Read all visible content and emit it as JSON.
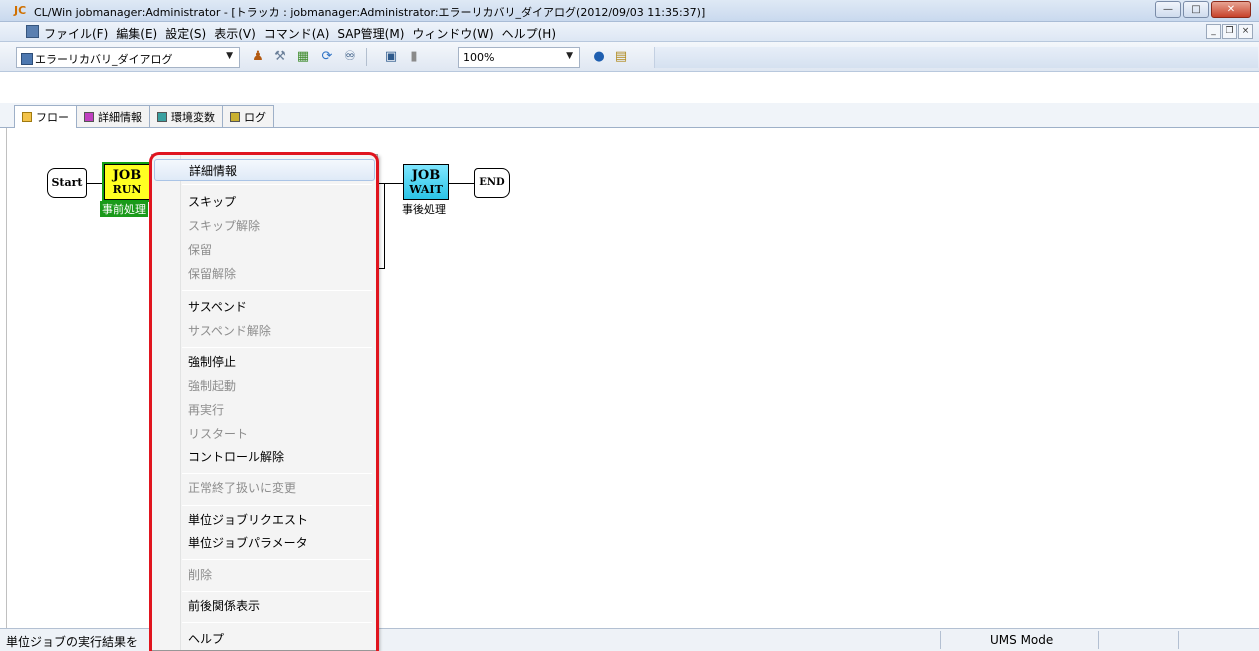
{
  "window": {
    "logo": "JC",
    "title": "CL/Win jobmanager:Administrator - [トラッカ : jobmanager:Administrator:エラーリカバリ_ダイアログ(2012/09/03 11:35:37)]",
    "minimize": "—",
    "maximize": "□",
    "close": "✕"
  },
  "menubar": {
    "items": [
      "ファイル(F)",
      "編集(E)",
      "設定(S)",
      "表示(V)",
      "コマンド(A)",
      "SAP管理(M)",
      "ウィンドウ(W)",
      "ヘルプ(H)"
    ],
    "mdi_minimize": "_",
    "mdi_restore": "❐",
    "mdi_close": "×"
  },
  "toolbar": {
    "jobnet_select": "エラーリカバリ_ダイアログ",
    "zoom_select": "100%",
    "icons": [
      "user-icon",
      "tools-icon",
      "network-icon",
      "refresh-icon",
      "binoculars-icon",
      "printer-icon",
      "page-icon",
      "help-icon",
      "job-list-icon"
    ]
  },
  "tabs": [
    "フロー",
    "詳細情報",
    "環境変数",
    "ログ"
  ],
  "flow": {
    "start": "Start",
    "end": "END",
    "job1": {
      "line1": "JOB",
      "line2": "RUN",
      "label": "事前処理"
    },
    "job2": {
      "line1": "JOB",
      "line2": "WAIT",
      "label": "事後処理"
    }
  },
  "context_menu": {
    "items": [
      {
        "label": "詳細情報",
        "enabled": true,
        "selected": true
      },
      {
        "label": "スキップ",
        "enabled": true
      },
      {
        "label": "スキップ解除",
        "enabled": false
      },
      {
        "label": "保留",
        "enabled": false
      },
      {
        "label": "保留解除",
        "enabled": false
      },
      {
        "label": "サスペンド",
        "enabled": true
      },
      {
        "label": "サスペンド解除",
        "enabled": false
      },
      {
        "label": "強制停止",
        "enabled": true
      },
      {
        "label": "強制起動",
        "enabled": false
      },
      {
        "label": "再実行",
        "enabled": false
      },
      {
        "label": "リスタート",
        "enabled": false
      },
      {
        "label": "コントロール解除",
        "enabled": true
      },
      {
        "label": "正常終了扱いに変更",
        "enabled": false
      },
      {
        "label": "単位ジョブリクエスト",
        "enabled": true
      },
      {
        "label": "単位ジョブパラメータ",
        "enabled": true
      },
      {
        "label": "削除",
        "enabled": false
      },
      {
        "label": "前後関係表示",
        "enabled": true
      },
      {
        "label": "ヘルプ",
        "enabled": true
      }
    ]
  },
  "statusbar": {
    "text": "単位ジョブの実行結果を",
    "mode": "UMS Mode"
  },
  "colors": {
    "highlight_ring": "#e0141e",
    "job_run": "#ffff22",
    "job_wait": "#2ac3e6",
    "selected_job_border": "#13a013"
  }
}
